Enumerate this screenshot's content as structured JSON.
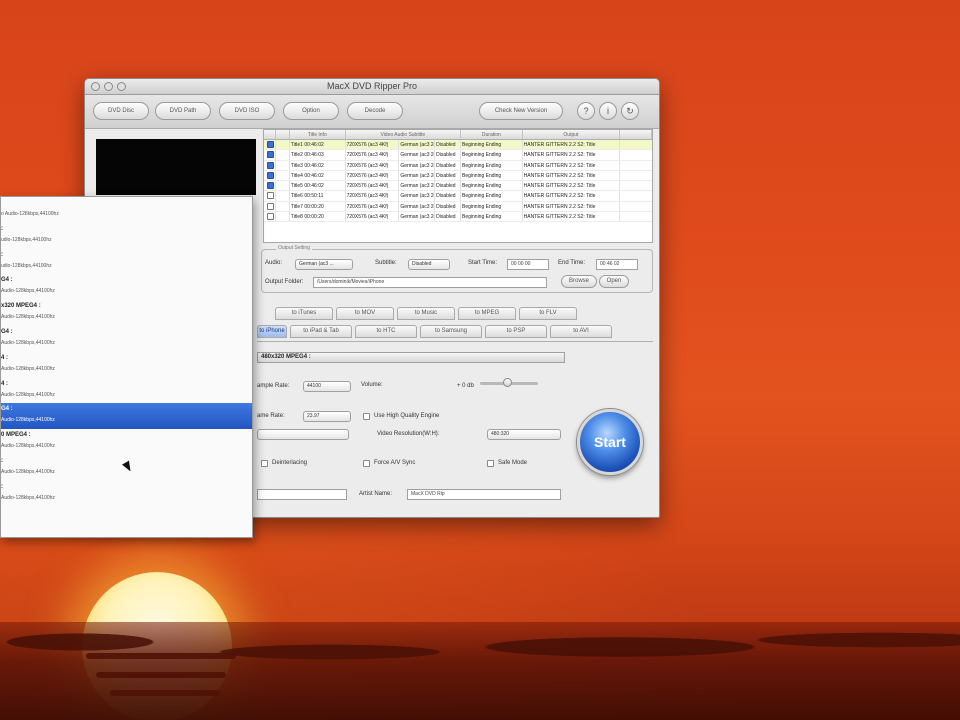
{
  "window": {
    "title": "MacX DVD Ripper Pro"
  },
  "toolbar": {
    "buttons": [
      "DVD Disc",
      "DVD Path",
      "DVD ISO",
      "Option",
      "Decode"
    ],
    "right_button": "Check New Version",
    "round_buttons": [
      "?",
      "i",
      "↻"
    ]
  },
  "titles_table": {
    "headers": [
      "",
      "",
      "Title Info",
      "Video Audio Subtitle",
      "",
      "",
      "Duration",
      "Output",
      ""
    ],
    "rows": [
      {
        "checked": true,
        "highlight": true,
        "title": "Title1",
        "time": "00:46:02",
        "codec": "720X576 (ac3 4Kf)",
        "audio": "German (ac3 2ch)",
        "sub": "Disabled",
        "duration": "Beginning Ending",
        "output": "HANTER GITTERN 2.2 S2: Title"
      },
      {
        "checked": true,
        "highlight": false,
        "title": "Title2",
        "time": "00:46:03",
        "codec": "720X576 (ac3 4Kf)",
        "audio": "German (ac3 2ch)",
        "sub": "Disabled",
        "duration": "Beginning Ending",
        "output": "HANTER GITTERN 2.2 S2: Title"
      },
      {
        "checked": true,
        "highlight": false,
        "title": "Title3",
        "time": "00:46:02",
        "codec": "720X576 (ac3 4Kf)",
        "audio": "German (ac3 2ch)",
        "sub": "Disabled",
        "duration": "Beginning Ending",
        "output": "HANTER GITTERN 2.2 S2: Title"
      },
      {
        "checked": true,
        "highlight": false,
        "title": "Title4",
        "time": "00:46:02",
        "codec": "720X576 (ac3 4Kf)",
        "audio": "German (ac3 2ch)",
        "sub": "Disabled",
        "duration": "Beginning Ending",
        "output": "HANTER GITTERN 2.2 S2: Title"
      },
      {
        "checked": true,
        "highlight": false,
        "title": "Title5",
        "time": "00:46:02",
        "codec": "720X576 (ac3 4Kf)",
        "audio": "German (ac3 2ch)",
        "sub": "Disabled",
        "duration": "Beginning Ending",
        "output": "HANTER GITTERN 2.2 S2: Title"
      },
      {
        "checked": false,
        "highlight": false,
        "title": "Title6",
        "time": "00:50:11",
        "codec": "720X576 (ac3 4Kf)",
        "audio": "German (ac3 2ch)",
        "sub": "Disabled",
        "duration": "Beginning Ending",
        "output": "HANTER GITTERN 2.2 S2: Title"
      },
      {
        "checked": false,
        "highlight": false,
        "title": "Title7",
        "time": "00:00:20",
        "codec": "720X576 (ac3 4Kf)",
        "audio": "German (ac3 2ch)",
        "sub": "Disabled",
        "duration": "Beginning Ending",
        "output": "HANTER GITTERN 2.2 S2: Title"
      },
      {
        "checked": false,
        "highlight": false,
        "title": "Title8",
        "time": "00:00:20",
        "codec": "720X576 (ac3 4Kf)",
        "audio": "German (ac3 2ch)",
        "sub": "Disabled",
        "duration": "Beginning Ending",
        "output": "HANTER GITTERN 2.2 S2: Title"
      }
    ]
  },
  "output_setting": {
    "legend": "Output Setting",
    "audio_label": "Audio:",
    "audio_value": "German (ac3 ...",
    "subtitle_label": "Subtitle:",
    "subtitle_value": "Disabled",
    "start_time_label": "Start Time:",
    "start_time_value": "00 00 00",
    "end_time_label": "End Time:",
    "end_time_value": "00 46 02",
    "output_folder_label": "Output Folder:",
    "output_folder_value": "/Users/dominik/Movies/iPhone",
    "browse_label": "Browse",
    "open_label": "Open"
  },
  "tabs_row1": [
    "to iTunes",
    "to MOV",
    "to Music",
    "to MPEG",
    "to FLV"
  ],
  "tabs_row2": [
    "to iPhone",
    "to iPad & Tab",
    "to HTC",
    "to Samsung",
    "to PSP",
    "to AVI"
  ],
  "profile": {
    "selected": "480x320 MPEG4 :",
    "sample_rate_label": "ample Rate:",
    "sample_rate_value": "44100",
    "volume_label": "Volume:",
    "volume_value": "+ 0 db",
    "frame_rate_label": "ame Rate:",
    "frame_rate_value": "23.97",
    "hq_engine_label": "Use High Quality Engine",
    "video_res_label": "Video Resolution(W:H):",
    "video_res_value": "480:320",
    "deinterlacing_label": "Deinterlacing",
    "force_av_sync_label": "Force A/V Sync",
    "safe_mode_label": "Safe Mode",
    "artist_name_label": "Artist Name:",
    "artist_name_value": "MacX DVD Rip"
  },
  "start_button": "Start",
  "dropdown": {
    "items": [
      {
        "name": "",
        "desc": "o Audio-128kbps,44100hz",
        "selected": false
      },
      {
        "name": ":",
        "desc": "udio-128kbps,44100hz",
        "selected": false
      },
      {
        "name": ":",
        "desc": "udio-128kbps,44100hz",
        "selected": false
      },
      {
        "name": "G4 :",
        "desc": "Audio-128kbps,44100hz",
        "selected": false
      },
      {
        "name": "x320 MPEG4 :",
        "desc": "Audio-128kbps,44100hz",
        "selected": false
      },
      {
        "name": "G4 :",
        "desc": "Audio-128kbps,44100hz",
        "selected": false
      },
      {
        "name": "4 :",
        "desc": "Audio-128kbps,44100hz",
        "selected": false
      },
      {
        "name": "4 :",
        "desc": "Audio-128kbps,44100hz",
        "selected": false
      },
      {
        "name": "G4 :",
        "desc": "Audio-128kbps,44100hz",
        "selected": true
      },
      {
        "name": "0 MPEG4 :",
        "desc": "Audio-128kbps,44100hz",
        "selected": false
      },
      {
        "name": ":",
        "desc": "Audio-128kbps,44100hz",
        "selected": false
      },
      {
        "name": ":",
        "desc": "Audio-128kbps,44100hz",
        "selected": false
      }
    ]
  }
}
